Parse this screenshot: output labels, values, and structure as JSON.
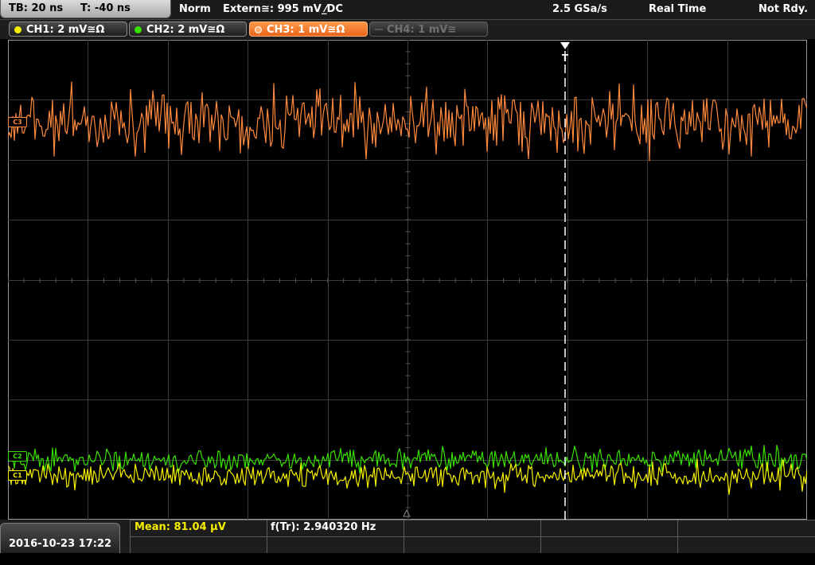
{
  "top_bar": {
    "timebase": "TB: 20 ns",
    "trigger_time": "T: -40 ns",
    "trigger_mode": "Norm",
    "trigger_source": "Extern≅: 995 mV ⁄̲DC",
    "sample_rate": "2.5 GSa/s",
    "acq_mode": "Real Time",
    "status": "Not Rdy."
  },
  "channels": [
    {
      "label": "CH1: 2 mV≅Ω",
      "color": "#f5f000",
      "state": "on"
    },
    {
      "label": "CH2: 2 mV≅Ω",
      "color": "#38e000",
      "state": "on"
    },
    {
      "label": "CH3: 1 mV≅Ω",
      "color": "#ff8a3c",
      "state": "active"
    },
    {
      "label": "CH4: 1 mV≅",
      "color": "#707070",
      "state": "off"
    }
  ],
  "markers": {
    "c3": "C3",
    "c2": "C2",
    "c1": "C1",
    "trigger": "T"
  },
  "colors": {
    "background": "#000000",
    "grid": "#3c3c3c",
    "ch1": "#f5f000",
    "ch2": "#38e000",
    "ch3": "#ff8a3c",
    "trigger": "#ffffff"
  },
  "bottom_bar": {
    "datetime": "2016-10-23 17:22",
    "mean": "Mean: 81.04 µV",
    "freq": "f(Tr): 2.940320 Hz"
  },
  "icons": {
    "trigger_marker": "trigger-arrow-icon",
    "center_marker": "center-triangle-icon"
  }
}
